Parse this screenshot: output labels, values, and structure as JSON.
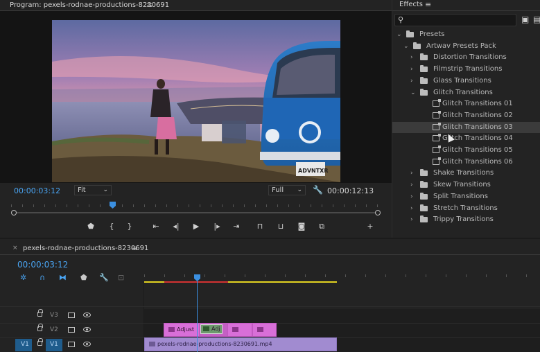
{
  "program": {
    "title": "Program: pexels-rodnae-productions-8230691",
    "menu_glyph": "≡",
    "timecode_current": "00:00:03:12",
    "timecode_duration": "00:00:12:13",
    "zoom": "Fit",
    "resolution": "Full",
    "playhead_fraction": 0.27,
    "video_plate": "ADVNTXR",
    "transport": [
      "add-marker",
      "mark-in",
      "mark-out",
      "go-to-in",
      "step-back",
      "play",
      "step-forward",
      "go-to-out",
      "lift",
      "extract",
      "export-frame",
      "comparison-view",
      "add"
    ]
  },
  "effects": {
    "title": "Effects",
    "menu_glyph": "≡",
    "search_value": "",
    "tree": [
      {
        "label": "Presets",
        "level": 0,
        "kind": "folder",
        "expanded": true
      },
      {
        "label": "Artwav Presets Pack",
        "level": 1,
        "kind": "folder",
        "expanded": true
      },
      {
        "label": "Distortion Transitions",
        "level": 2,
        "kind": "folder",
        "expanded": false
      },
      {
        "label": "Filmstrip Transitions",
        "level": 2,
        "kind": "folder",
        "expanded": false
      },
      {
        "label": "Glass Transitions",
        "level": 2,
        "kind": "folder",
        "expanded": false
      },
      {
        "label": "Glitch Transitions",
        "level": 2,
        "kind": "folder",
        "expanded": true
      },
      {
        "label": "Glitch Transitions 01",
        "level": 3,
        "kind": "preset"
      },
      {
        "label": "Glitch Transitions 02",
        "level": 3,
        "kind": "preset"
      },
      {
        "label": "Glitch Transitions 03",
        "level": 3,
        "kind": "preset",
        "selected": true
      },
      {
        "label": "Glitch Transitions 04",
        "level": 3,
        "kind": "preset"
      },
      {
        "label": "Glitch Transitions 05",
        "level": 3,
        "kind": "preset"
      },
      {
        "label": "Glitch Transitions 06",
        "level": 3,
        "kind": "preset"
      },
      {
        "label": "Shake Transitions",
        "level": 2,
        "kind": "folder",
        "expanded": false
      },
      {
        "label": "Skew Transitions",
        "level": 2,
        "kind": "folder",
        "expanded": false
      },
      {
        "label": "Split Transitions",
        "level": 2,
        "kind": "folder",
        "expanded": false
      },
      {
        "label": "Stretch Transitions",
        "level": 2,
        "kind": "folder",
        "expanded": false
      },
      {
        "label": "Trippy Transitions",
        "level": 2,
        "kind": "folder",
        "expanded": false
      }
    ]
  },
  "timeline": {
    "close_glyph": "×",
    "menu_glyph": "≡",
    "sequence_name": "pexels-rodnae-productions-8230691",
    "timecode": "00:00:03:12",
    "tracks": [
      {
        "name": "V3",
        "target": ""
      },
      {
        "name": "V2",
        "target": ""
      },
      {
        "name": "V1",
        "target": "V1"
      }
    ],
    "clips": {
      "v2_adjust_label": "Adjust",
      "v2_adj_label": "Adj",
      "v1_label": "pexels-rodnae-productions-8230691.mp4"
    }
  },
  "colors": {
    "accent_blue": "#4aa6f5",
    "playhead": "#3b8fe0",
    "clip_pink": "#d86fd8",
    "clip_violet": "#a18bd0",
    "workarea_yellow": "#e3d321",
    "workarea_red": "#d43232"
  }
}
